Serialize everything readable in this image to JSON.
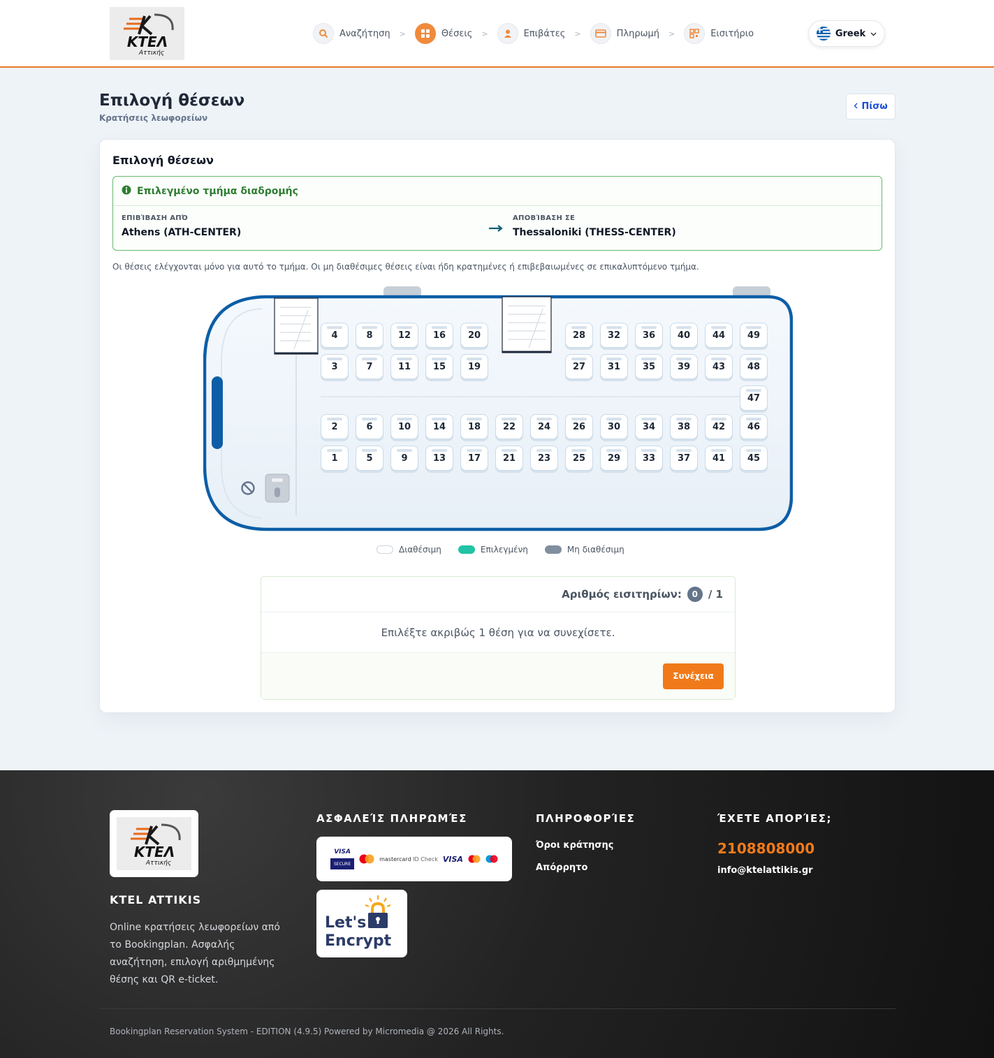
{
  "header": {
    "logo": {
      "text": "ΚΤΕΛ",
      "sub": "Αττικής"
    },
    "steps": [
      {
        "label": "Αναζήτηση",
        "icon": "search-icon"
      },
      {
        "label": "Θέσεις",
        "icon": "seats-grid-icon"
      },
      {
        "label": "Επιβάτες",
        "icon": "user-icon"
      },
      {
        "label": "Πληρωμή",
        "icon": "credit-card-icon"
      },
      {
        "label": "Εισιτήριο",
        "icon": "qr-code-icon"
      }
    ],
    "step_separator": ">",
    "active_step": 1,
    "language": "Greek"
  },
  "page": {
    "title": "Επιλογή θέσεων",
    "subtitle": "Κρατήσεις λεωφορείων",
    "back_label": "Πίσω"
  },
  "card": {
    "title": "Επιλογή θέσεων",
    "segment": {
      "heading": "Επιλεγμένο τμήμα διαδρομής",
      "from_label": "ΕΠΙΒΊΒΑΣΗ ΑΠΌ",
      "from_value": "Athens (ATH-CENTER)",
      "to_label": "ΑΠΟΒΊΒΑΣΗ ΣΕ",
      "to_value": "Thessaloniki (THESS-CENTER)"
    },
    "note": "Οι θέσεις ελέγχονται μόνο για αυτό το τμήμα. Οι μη διαθέσιμες θέσεις είναι ήδη κρατημένες ή επιβεβαιωμένες σε επικαλυπτόμενο τμήμα.",
    "seats": {
      "row1": [
        "4",
        "8",
        "12",
        "16",
        "20",
        "28",
        "32",
        "36",
        "40",
        "44",
        "49"
      ],
      "row2": [
        "3",
        "7",
        "11",
        "15",
        "19",
        "27",
        "31",
        "35",
        "39",
        "43",
        "48"
      ],
      "middle": [
        "47"
      ],
      "row3": [
        "2",
        "6",
        "10",
        "14",
        "18",
        "22",
        "24",
        "26",
        "30",
        "34",
        "38",
        "42",
        "46"
      ],
      "row4": [
        "1",
        "5",
        "9",
        "13",
        "17",
        "21",
        "23",
        "25",
        "29",
        "33",
        "37",
        "41",
        "45"
      ]
    },
    "legend": [
      {
        "label": "Διαθέσιμη",
        "color": "#ffffff"
      },
      {
        "label": "Επιλεγμένη",
        "color": "#20c3a5"
      },
      {
        "label": "Μη διαθέσιμη",
        "color": "#7f8fa0"
      }
    ],
    "tickets": {
      "label": "Αριθμός εισιτηρίων:",
      "selected": "0",
      "total": "/ 1",
      "message": "Επιλέξτε ακριβώς 1 θέση για να συνεχίσετε.",
      "continue_label": "Συνέχεια"
    }
  },
  "footer": {
    "brand": "KTEL ATTIKIS",
    "description": "Online κρατήσεις λεωφορείων από το Bookingplan. Ασφαλής αναζήτηση, επιλογή αριθμημένης θέσης και QR e-ticket.",
    "payments_heading": "ΑΣΦΑΛΕΊΣ ΠΛΗΡΩΜΈΣ",
    "payment_marks": {
      "visa_secure_top": "VISA",
      "visa_secure_bottom": "SECURE",
      "mastercard": "mastercard",
      "id_check": "ID Check",
      "visa": "VISA"
    },
    "lets_encrypt": [
      "Let's",
      "Encrypt"
    ],
    "info_heading": "ΠΛΗΡΟΦΟΡΊΕΣ",
    "links": [
      "Όροι κράτησης",
      "Απόρρητο"
    ],
    "contact_heading": "ΈΧΕΤΕ ΑΠΟΡΊΕΣ;",
    "phone": "2108808000",
    "email": "info@ktelattikis.gr",
    "copyright": "Bookingplan Reservation System - EDITION (4.9.5) Powered by Micromedia @ 2026 All Rights."
  },
  "colors": {
    "accent": "#f07a1a",
    "bus_outline": "#0d5ea6",
    "success": "#2f7d32"
  }
}
